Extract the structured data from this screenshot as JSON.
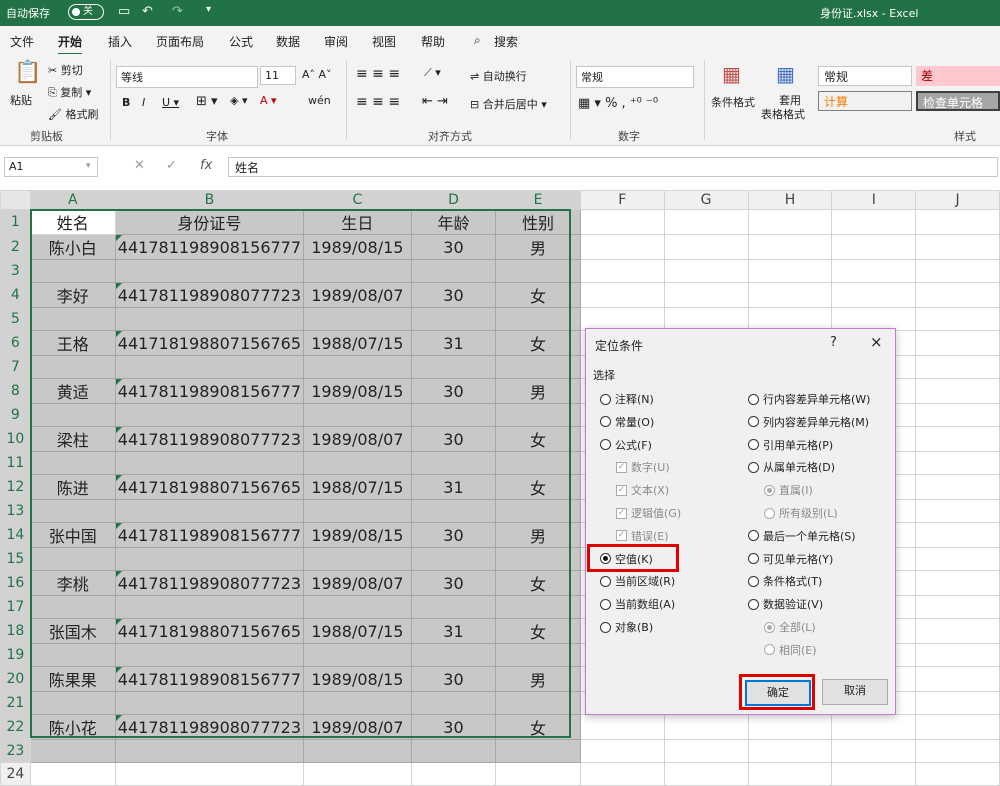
{
  "titlebar": {
    "autosave_label": "自动保存",
    "autosave_state": "关",
    "doc_title": "身份证.xlsx  -  Excel"
  },
  "tabs": [
    "文件",
    "开始",
    "插入",
    "页面布局",
    "公式",
    "数据",
    "审阅",
    "视图",
    "帮助",
    "搜索"
  ],
  "ribbon": {
    "paste": "粘贴",
    "cut": "剪切",
    "copy": "复制",
    "format_painter": "格式刷",
    "clipboard": "剪贴板",
    "font_name": "等线",
    "font_size": "11",
    "font": "字体",
    "wrap_text": "自动换行",
    "merge_center": "合并后居中",
    "alignment": "对齐方式",
    "number_format": "常规",
    "number": "数字",
    "conditional_format": "条件格式",
    "table_format_1": "套用",
    "table_format_2": "表格格式",
    "style_normal": "常规",
    "style_bad": "差",
    "style_calc": "计算",
    "style_check": "检查单元格",
    "styles": "样式"
  },
  "formula_bar": {
    "name_box": "A1",
    "formula": "姓名"
  },
  "grid": {
    "columns": [
      "A",
      "B",
      "C",
      "D",
      "E",
      "F",
      "G",
      "H",
      "I",
      "J"
    ],
    "rows": [
      [
        "姓名",
        "身份证号",
        "生日",
        "年龄",
        "性别"
      ],
      [
        "陈小白",
        "441781198908156777",
        "1989/08/15",
        "30",
        "男"
      ],
      [
        "",
        "",
        "",
        "",
        ""
      ],
      [
        "李好",
        "441781198908077723",
        "1989/08/07",
        "30",
        "女"
      ],
      [
        "",
        "",
        "",
        "",
        ""
      ],
      [
        "王格",
        "441718198807156765",
        "1988/07/15",
        "31",
        "女"
      ],
      [
        "",
        "",
        "",
        "",
        ""
      ],
      [
        "黄适",
        "441781198908156777",
        "1989/08/15",
        "30",
        "男"
      ],
      [
        "",
        "",
        "",
        "",
        ""
      ],
      [
        "梁柱",
        "441781198908077723",
        "1989/08/07",
        "30",
        "女"
      ],
      [
        "",
        "",
        "",
        "",
        ""
      ],
      [
        "陈进",
        "441718198807156765",
        "1988/07/15",
        "31",
        "女"
      ],
      [
        "",
        "",
        "",
        "",
        ""
      ],
      [
        "张中国",
        "441781198908156777",
        "1989/08/15",
        "30",
        "男"
      ],
      [
        "",
        "",
        "",
        "",
        ""
      ],
      [
        "李桃",
        "441781198908077723",
        "1989/08/07",
        "30",
        "女"
      ],
      [
        "",
        "",
        "",
        "",
        ""
      ],
      [
        "张国木",
        "441718198807156765",
        "1988/07/15",
        "31",
        "女"
      ],
      [
        "",
        "",
        "",
        "",
        ""
      ],
      [
        "陈果果",
        "441781198908156777",
        "1989/08/15",
        "30",
        "男"
      ],
      [
        "",
        "",
        "",
        "",
        ""
      ],
      [
        "陈小花",
        "441781198908077723",
        "1989/08/07",
        "30",
        "女"
      ],
      [
        "",
        "",
        "",
        "",
        ""
      ],
      [
        "",
        "",
        "",
        "",
        ""
      ]
    ]
  },
  "dialog": {
    "title": "定位条件",
    "help": "?",
    "close": "×",
    "section": "选择",
    "left_options": [
      {
        "label": "注释(N)",
        "type": "radio"
      },
      {
        "label": "常量(O)",
        "type": "radio"
      },
      {
        "label": "公式(F)",
        "type": "radio"
      },
      {
        "label": "数字(U)",
        "type": "check",
        "disabled": true
      },
      {
        "label": "文本(X)",
        "type": "check",
        "disabled": true
      },
      {
        "label": "逻辑值(G)",
        "type": "check",
        "disabled": true
      },
      {
        "label": "错误(E)",
        "type": "check",
        "disabled": true
      },
      {
        "label": "空值(K)",
        "type": "radio",
        "checked": true
      },
      {
        "label": "当前区域(R)",
        "type": "radio"
      },
      {
        "label": "当前数组(A)",
        "type": "radio"
      },
      {
        "label": "对象(B)",
        "type": "radio"
      }
    ],
    "right_options": [
      {
        "label": "行内容差异单元格(W)",
        "type": "radio"
      },
      {
        "label": "列内容差异单元格(M)",
        "type": "radio"
      },
      {
        "label": "引用单元格(P)",
        "type": "radio"
      },
      {
        "label": "从属单元格(D)",
        "type": "radio"
      },
      {
        "label": "直属(I)",
        "type": "radio",
        "disabled": true,
        "checked": true
      },
      {
        "label": "所有级别(L)",
        "type": "radio",
        "disabled": true
      },
      {
        "label": "最后一个单元格(S)",
        "type": "radio"
      },
      {
        "label": "可见单元格(Y)",
        "type": "radio"
      },
      {
        "label": "条件格式(T)",
        "type": "radio"
      },
      {
        "label": "数据验证(V)",
        "type": "radio"
      },
      {
        "label": "全部(L)",
        "type": "radio",
        "disabled": true,
        "checked": true
      },
      {
        "label": "相同(E)",
        "type": "radio",
        "disabled": true
      }
    ],
    "ok": "确定",
    "cancel": "取消"
  },
  "colors": {
    "excel_green": "#217346",
    "selection": "#c8c8c8",
    "highlight": "#e00000"
  }
}
